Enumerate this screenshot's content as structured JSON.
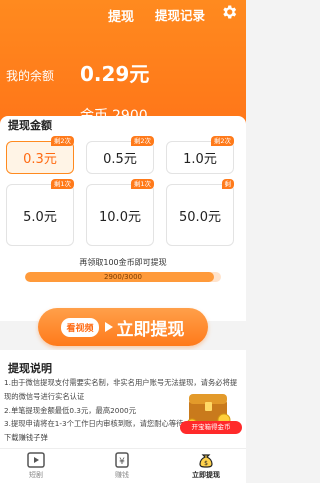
{
  "header": {
    "title": "提现",
    "record_link": "提现记录",
    "balance_label": "我的余额",
    "balance_value": "0.29元",
    "coin_label": "金币",
    "coin_value": "2900"
  },
  "withdraw": {
    "section_title": "提现金额",
    "options": [
      {
        "amount": "0.3元",
        "badge": "剩2次",
        "selected": true
      },
      {
        "amount": "0.5元",
        "badge": "剩2次",
        "selected": false
      },
      {
        "amount": "1.0元",
        "badge": "剩2次",
        "selected": false
      },
      {
        "amount": "5.0元",
        "badge": "剩1次",
        "selected": false
      },
      {
        "amount": "10.0元",
        "badge": "剩1次",
        "selected": false
      },
      {
        "amount": "50.0元",
        "badge": "剩",
        "selected": false
      }
    ],
    "hint": "再领取100金币即可提现",
    "progress_text": "2900/3000",
    "progress_fraction": 0.9667
  },
  "cta": {
    "tag": "看视频",
    "label": "立即提现"
  },
  "notes": {
    "title": "提现说明",
    "text": "1.由于微信提现支付需要实名制，非实名用户账号无法提现，请务必将提现的微信号进行实名认证\n2.单笔提现金额最低0.3元，最高2000元\n3.提现申请将在1-3个工作日内审核到账，请您耐心等待\n下载赚钱子弹"
  },
  "chest": {
    "label": "开宝箱得金币"
  },
  "tabbar": {
    "items": [
      {
        "label": "短剧",
        "icon": "film-icon",
        "active": false
      },
      {
        "label": "赚钱",
        "icon": "money-icon",
        "active": false
      },
      {
        "label": "立即提现",
        "icon": "money-bag-icon",
        "active": true
      }
    ]
  },
  "colors": {
    "accent": "#ff7a1a",
    "header_bg": "#ff8a1f",
    "selected_bg": "#fff4e6",
    "chest_badge": "#ff2a2a"
  }
}
